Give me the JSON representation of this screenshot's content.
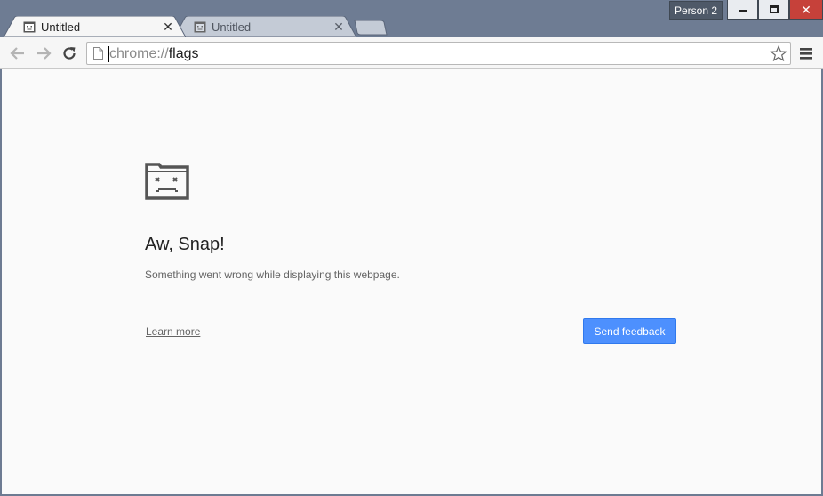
{
  "window": {
    "profile_label": "Person 2"
  },
  "tabs": [
    {
      "title": "Untitled",
      "active": true
    },
    {
      "title": "Untitled",
      "active": false
    }
  ],
  "omnibox": {
    "url_scheme": "chrome://",
    "url_host": "flags"
  },
  "error_page": {
    "icon": "sad-tab-icon",
    "title": "Aw, Snap!",
    "description": "Something went wrong while displaying this webpage.",
    "learn_more_label": "Learn more",
    "send_feedback_label": "Send feedback"
  },
  "colors": {
    "frame": "#6e7c93",
    "close_button": "#c6413a",
    "feedback_button": "#4d90fe",
    "content_background": "#fafafa"
  }
}
